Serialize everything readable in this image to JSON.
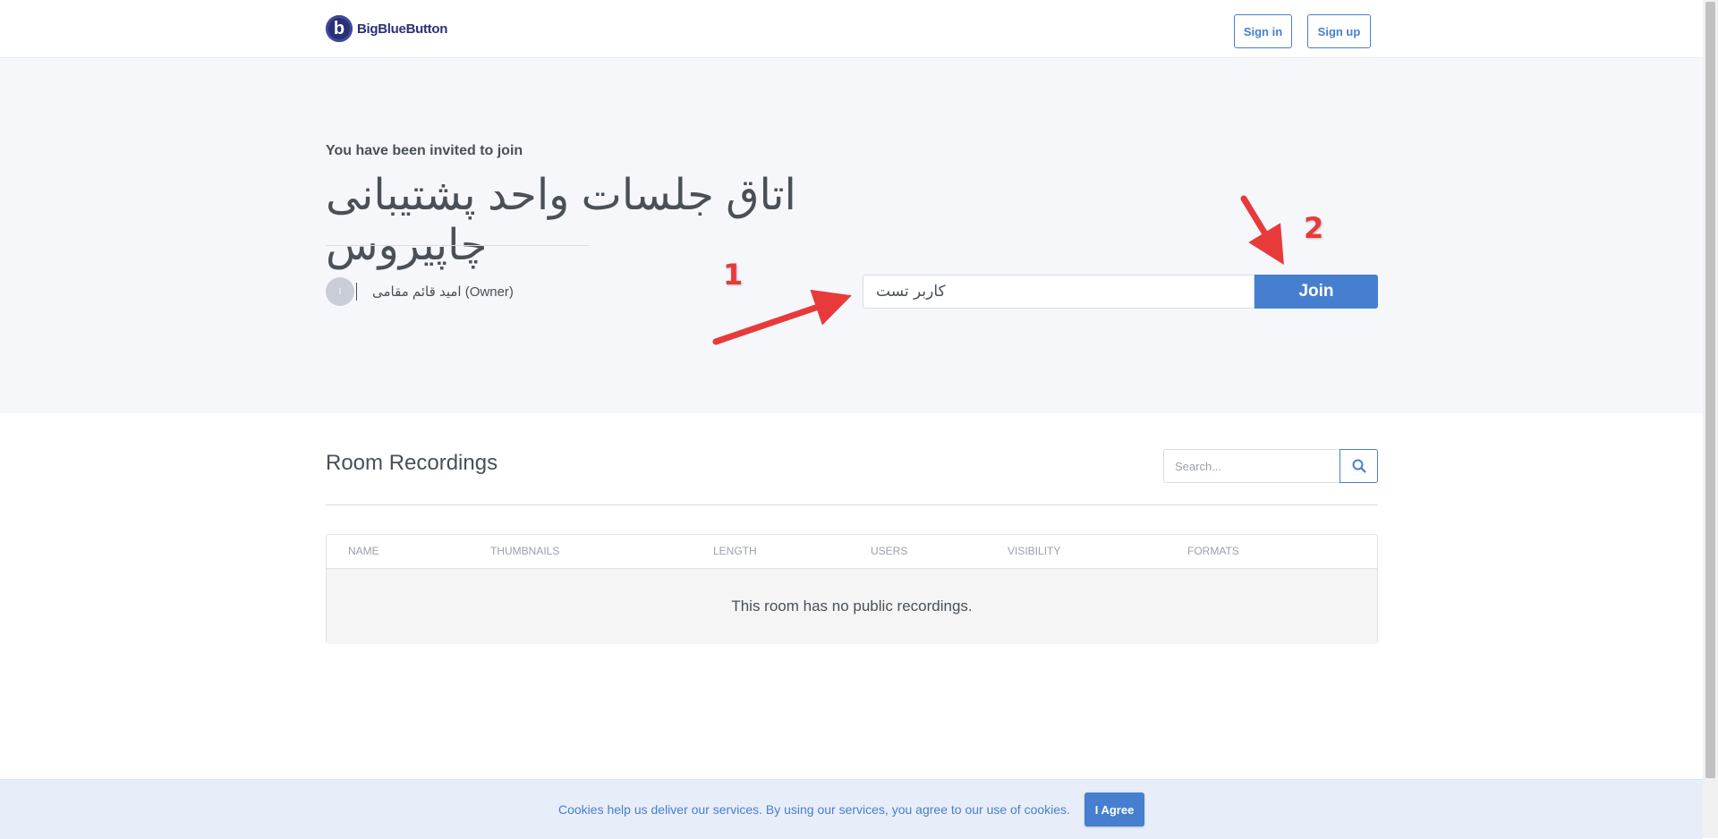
{
  "header": {
    "logo_text": "BigBlueButton",
    "signin_label": "Sign in",
    "signup_label": "Sign up"
  },
  "hero": {
    "invited_text": "You have been invited to join",
    "room_title": "اتاق جلسات واحد پشتیبانی چاپیروس",
    "owner_initial": "ا",
    "owner_name": "امید قائم مقامی (Owner)",
    "name_input_value": "کاربر تست",
    "join_label": "Join"
  },
  "annotations": {
    "marker_1": "1",
    "marker_2": "2",
    "color": "#e83a3a"
  },
  "recordings": {
    "title": "Room Recordings",
    "search_placeholder": "Search...",
    "columns": [
      "NAME",
      "THUMBNAILS",
      "LENGTH",
      "USERS",
      "VISIBILITY",
      "FORMATS"
    ],
    "empty_message": "This room has no public recordings."
  },
  "cookie": {
    "text": "Cookies help us deliver our services. By using our services, you agree to our use of cookies.",
    "agree_label": "I Agree"
  },
  "colors": {
    "accent": "#467fcf",
    "hero_bg": "#f5f7fb",
    "cookie_bg": "#e8eef9",
    "logo_dark": "#283274"
  }
}
